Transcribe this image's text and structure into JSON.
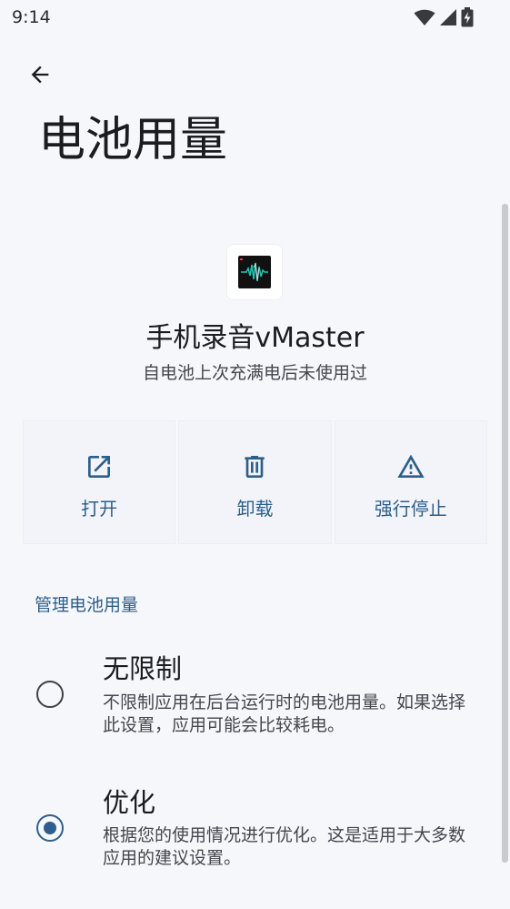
{
  "status_bar": {
    "time": "9:14",
    "icons": [
      "wifi-icon",
      "cellular-signal-icon",
      "battery-charging-icon"
    ]
  },
  "header": {
    "back_icon": "arrow-back-icon",
    "title": "电池用量"
  },
  "app": {
    "name": "手机录音vMaster",
    "summary": "自电池上次充满电后未使用过"
  },
  "actions": [
    {
      "label": "打开",
      "icon": "open-external-icon"
    },
    {
      "label": "卸载",
      "icon": "trash-icon"
    },
    {
      "label": "强行停止",
      "icon": "warning-icon"
    }
  ],
  "section": {
    "title": "管理电池用量"
  },
  "options": [
    {
      "title": "无限制",
      "description": "不限制应用在后台运行时的电池用量。如果选择此设置，应用可能会比较耗电。",
      "selected": false
    },
    {
      "title": "优化",
      "description": "根据您的使用情况进行优化。这是适用于大多数应用的建议设置。",
      "selected": true
    }
  ],
  "colors": {
    "accent": "#2c5f8a",
    "background": "#f6f7fb",
    "text_primary": "#1b1c20",
    "text_secondary": "#45464b"
  }
}
